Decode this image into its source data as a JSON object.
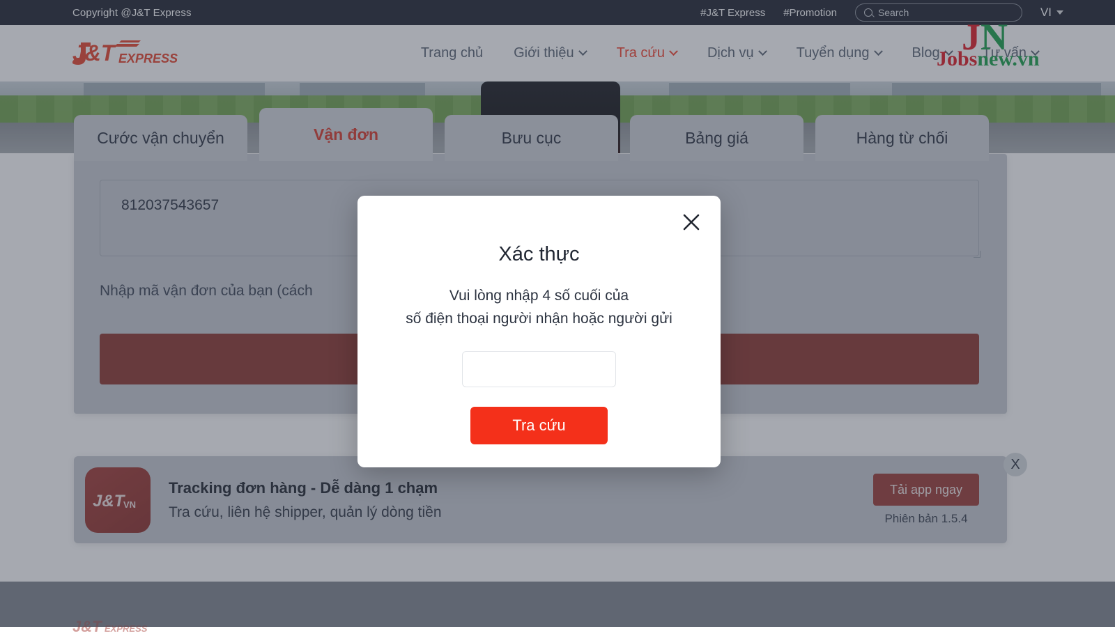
{
  "topbar": {
    "copyright": "Copyright @J&T Express",
    "hashtag_1": "#J&T Express",
    "hashtag_2": "#Promotion",
    "search_placeholder": "Search",
    "language": "VI"
  },
  "nav": {
    "logo_main": "J&T",
    "logo_sub": "EXPRESS",
    "items": [
      {
        "label": "Trang chủ",
        "has_caret": false,
        "active": false
      },
      {
        "label": "Giới thiệu",
        "has_caret": true,
        "active": false
      },
      {
        "label": "Tra cứu",
        "has_caret": true,
        "active": true
      },
      {
        "label": "Dịch vụ",
        "has_caret": true,
        "active": false
      },
      {
        "label": "Tuyển dụng",
        "has_caret": true,
        "active": false
      },
      {
        "label": "Blog",
        "has_caret": true,
        "active": false
      },
      {
        "label": "Tư vấn",
        "has_caret": true,
        "active": false
      }
    ]
  },
  "watermark": {
    "mark_j": "J",
    "mark_n": "N",
    "word_red": "Jobs",
    "word_green": "new.vn"
  },
  "tabs": [
    {
      "label": "Cước vận chuyển",
      "active": false
    },
    {
      "label": "Vận đơn",
      "active": true
    },
    {
      "label": "Bưu cục",
      "active": false
    },
    {
      "label": "Bảng giá",
      "active": false
    },
    {
      "label": "Hàng từ chối",
      "active": false
    }
  ],
  "tracking": {
    "value": "812037543657",
    "hint": "Nhập mã vận đơn của bạn (cách",
    "search_button": ""
  },
  "app_banner": {
    "icon_main": "J&T",
    "icon_sub": "VN",
    "title": "Tracking đơn hàng - Dễ dàng 1 chạm",
    "subtitle": "Tra cứu, liên hệ shipper, quản lý dòng tiền",
    "download_button": "Tải app ngay",
    "version": "Phiên bản 1.5.4",
    "close": "X"
  },
  "modal": {
    "title": "Xác thực",
    "desc_line_1": "Vui lòng nhập 4 số cuối của",
    "desc_line_2": "số điện thoại người nhận hoặc người gửi",
    "input_value": "",
    "input_placeholder": "",
    "submit_label": "Tra cứu"
  },
  "colors": {
    "brand_red": "#f4402c",
    "modal_button_red": "#f4301a",
    "topbar_dark": "#1f2430",
    "dim_overlay": "rgba(58,65,79,.45)"
  }
}
